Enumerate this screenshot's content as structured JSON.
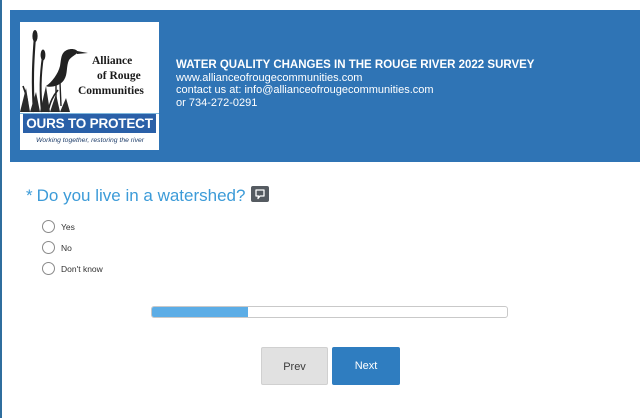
{
  "brand": {
    "logo_line1": "Alliance",
    "logo_line2": "of Rouge",
    "logo_line3": "Communities",
    "banner": "OURS TO PROTECT",
    "tagline": "Working together, restoring the river"
  },
  "header": {
    "title": "WATER QUALITY CHANGES IN THE ROUGE RIVER 2022 SURVEY",
    "website": "www.allianceofrougecommunities.com",
    "contact": "contact us at:  info@allianceofrougecommunities.com",
    "phone": "or 734-272-0291"
  },
  "question": {
    "required_marker": "*",
    "text": "Do you live in a watershed?",
    "comment_icon": "speech-bubble-icon",
    "options": [
      "Yes",
      "No",
      "Don't know"
    ]
  },
  "progress": {
    "fraction": 0.27
  },
  "nav": {
    "prev_label": "Prev",
    "next_label": "Next"
  },
  "colors": {
    "header_bg": "#2f74b5",
    "accent": "#3c9bd8",
    "next_button": "#2f7dc0",
    "progress_fill": "#5cade6"
  }
}
